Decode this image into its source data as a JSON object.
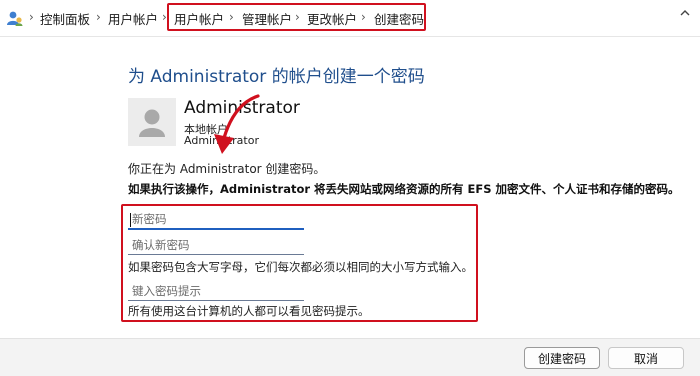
{
  "breadcrumb": {
    "items": [
      {
        "label": "控制面板"
      },
      {
        "label": "用户帐户"
      },
      {
        "label": "用户帐户"
      },
      {
        "label": "管理帐户"
      },
      {
        "label": "更改帐户"
      },
      {
        "label": "创建密码"
      }
    ]
  },
  "page": {
    "title": "为 Administrator 的帐户创建一个密码"
  },
  "user": {
    "name": "Administrator",
    "type": "本地帐户",
    "status": "Administrator"
  },
  "info_text": "你正在为 Administrator 创建密码。",
  "warning_text": "如果执行该操作，Administrator 将丢失网站或网络资源的所有 EFS 加密文件、个人证书和存储的密码。",
  "form": {
    "new_password_placeholder": "新密码",
    "confirm_password_placeholder": "确认新密码",
    "caps_hint": "如果密码包含大写字母，它们每次都必须以相同的大小写方式输入。",
    "password_hint_placeholder": "键入密码提示",
    "hint_visibility_note": "所有使用这台计算机的人都可以看见密码提示。"
  },
  "buttons": {
    "create_label": "创建密码",
    "cancel_label": "取消"
  },
  "colors": {
    "title": "#1f4e8c",
    "annotation_red": "#d0101e",
    "footer_bg": "#f3f3f3"
  },
  "icons": {
    "app": "user-accounts-icon",
    "separator": "chevron-right-icon",
    "scroll": "chevron-up-icon",
    "avatar": "user-avatar-icon",
    "annotation": "red-curved-arrow"
  }
}
